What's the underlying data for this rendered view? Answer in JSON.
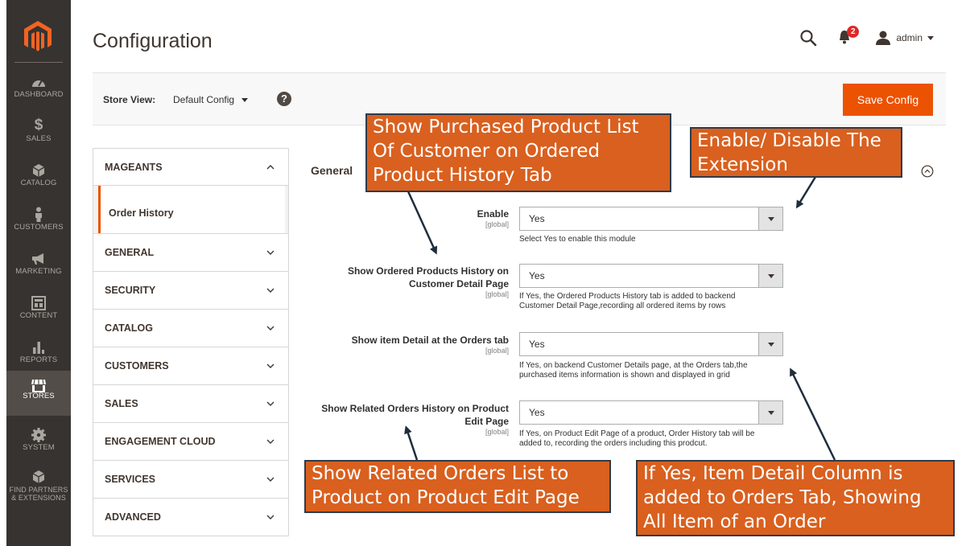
{
  "nav": {
    "items": [
      {
        "key": "dashboard",
        "label": "DASHBOARD",
        "icon": "dashboard-icon"
      },
      {
        "key": "sales",
        "label": "SALES",
        "icon": "dollar-icon"
      },
      {
        "key": "catalog",
        "label": "CATALOG",
        "icon": "box-icon"
      },
      {
        "key": "customers",
        "label": "CUSTOMERS",
        "icon": "person-icon"
      },
      {
        "key": "marketing",
        "label": "MARKETING",
        "icon": "megaphone-icon"
      },
      {
        "key": "content",
        "label": "CONTENT",
        "icon": "layout-icon"
      },
      {
        "key": "reports",
        "label": "REPORTS",
        "icon": "bar-chart-icon"
      },
      {
        "key": "stores",
        "label": "STORES",
        "icon": "storefront-icon",
        "active": true
      },
      {
        "key": "system",
        "label": "SYSTEM",
        "icon": "gear-icon"
      },
      {
        "key": "partners",
        "label": "FIND PARTNERS & EXTENSIONS",
        "icon": "cube-icon"
      }
    ],
    "partners_line1": "FIND PARTNERS",
    "partners_line2": "& EXTENSIONS"
  },
  "header": {
    "title": "Configuration",
    "notifications_count": "2",
    "user": "admin"
  },
  "store_bar": {
    "label": "Store View:",
    "value": "Default Config",
    "help": "?",
    "save_label": "Save Config"
  },
  "tabs": {
    "active_group": "MAGEANTS",
    "active_item": "Order History",
    "groups": [
      "GENERAL",
      "SECURITY",
      "CATALOG",
      "CUSTOMERS",
      "SALES",
      "ENGAGEMENT CLOUD",
      "SERVICES",
      "ADVANCED"
    ]
  },
  "section": {
    "title": "General",
    "fields": [
      {
        "label": "Enable",
        "scope": "[global]",
        "value": "Yes",
        "note": "Select Yes to enable this module"
      },
      {
        "label_line1": "Show Ordered Products History on",
        "label_line2": "Customer Detail Page",
        "scope": "[global]",
        "value": "Yes",
        "note_line1": "If Yes, the Ordered Products History tab is added to backend",
        "note_line2": "Customer Detail Page,recording all ordered items by rows"
      },
      {
        "label": "Show item Detail at the Orders tab",
        "scope": "[global]",
        "value": "Yes",
        "note_line1": "If Yes, on backend Customer Details page, at the Orders tab,the",
        "note_line2": "purchased items information is shown and displayed in grid"
      },
      {
        "label_line1": "Show Related Orders History on Product",
        "label_line2": "Edit Page",
        "scope": "[global]",
        "value": "Yes",
        "note_line1": "If Yes, on Product Edit Page of a product, Order History tab will be",
        "note_line2": "added to, recording the orders including this prodcut."
      }
    ]
  },
  "callouts": {
    "purchased": [
      "Show Purchased Product List",
      "Of Customer on Ordered",
      "Product History Tab"
    ],
    "enable": [
      "Enable/ Disable The",
      "Extension"
    ],
    "related": [
      "Show Related Orders List to",
      "Product on Product Edit Page"
    ],
    "item_detail": [
      "If Yes, Item Detail Column is",
      "added to Orders Tab, Showing",
      "All Item of an Order"
    ]
  },
  "colors": {
    "nav_bg": "#373330",
    "accent": "#eb5202",
    "callout_bg": "#d9601f",
    "callout_border": "#2d3b4a"
  }
}
